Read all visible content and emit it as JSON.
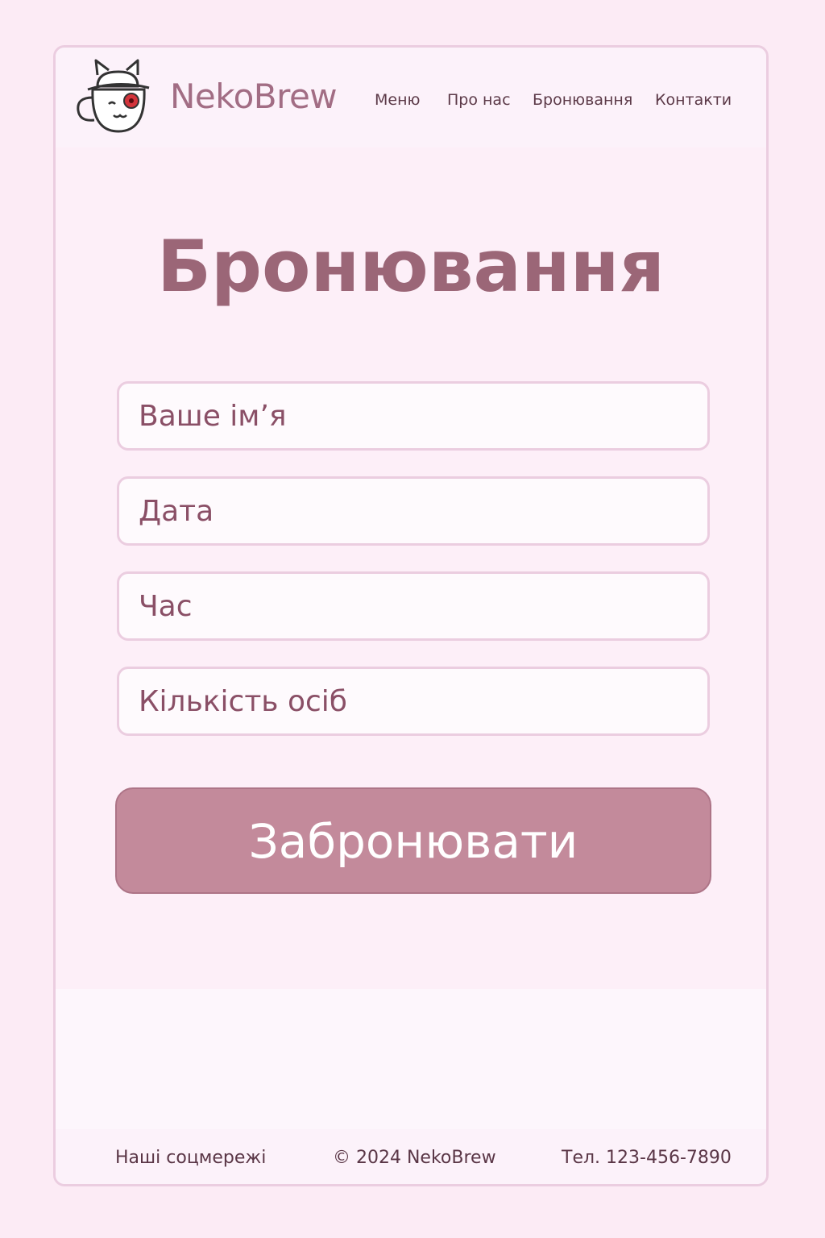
{
  "header": {
    "brand": "NekoBrew",
    "logo_icon": "cat-mug-icon",
    "nav": {
      "menu": "Меню",
      "about": "Про нас",
      "booking": "Бронювання",
      "contacts": "Контакти"
    }
  },
  "main": {
    "title": "Бронювання",
    "form": {
      "name_placeholder": "Ваше ім’я",
      "date_placeholder": "Дата",
      "time_placeholder": "Час",
      "guests_placeholder": "Кількість осіб",
      "submit_label": "Забронювати"
    }
  },
  "footer": {
    "social": "Наші соцмережі",
    "copyright": "© 2024 NekoBrew",
    "phone": "Тел. 123-456-7890"
  },
  "colors": {
    "background": "#fcebf5",
    "accent": "#c38a9b",
    "title": "#9b6677",
    "brand": "#a26d84",
    "field_border": "#ebcde0"
  }
}
